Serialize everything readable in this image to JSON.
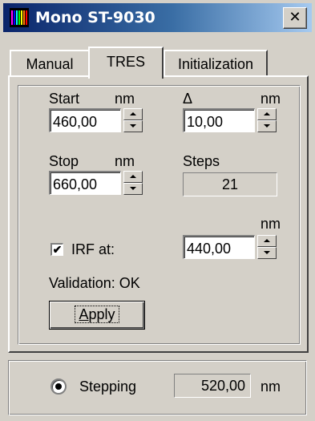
{
  "window": {
    "title": "Mono ST-9030",
    "close_glyph": "✕"
  },
  "tabs": [
    {
      "label": "Manual",
      "active": false
    },
    {
      "label": "TRES",
      "active": true
    },
    {
      "label": "Initialization",
      "active": false
    }
  ],
  "tres": {
    "start_label": "Start",
    "start_unit": "nm",
    "start_value": "460,00",
    "delta_label": "Δ",
    "delta_unit": "nm",
    "delta_value": "10,00",
    "stop_label": "Stop",
    "stop_unit": "nm",
    "stop_value": "660,00",
    "steps_label": "Steps",
    "steps_value": "21",
    "irf_checked": true,
    "irf_check_glyph": "✔",
    "irf_label": "IRF at:",
    "irf_unit": "nm",
    "irf_value": "440,00",
    "validation_text": "Validation: OK",
    "apply_label": "Apply"
  },
  "bottom": {
    "stepping_label": "Stepping",
    "stepping_value": "520,00",
    "stepping_unit": "nm"
  },
  "icons": {
    "app": "spectrum-icon",
    "close": "close-icon",
    "spin_up": "spin-up-icon",
    "spin_down": "spin-down-icon"
  },
  "colors": {
    "titlebar_start": "#0a246a",
    "titlebar_end": "#a6caf0",
    "face": "#d4d0c8"
  }
}
